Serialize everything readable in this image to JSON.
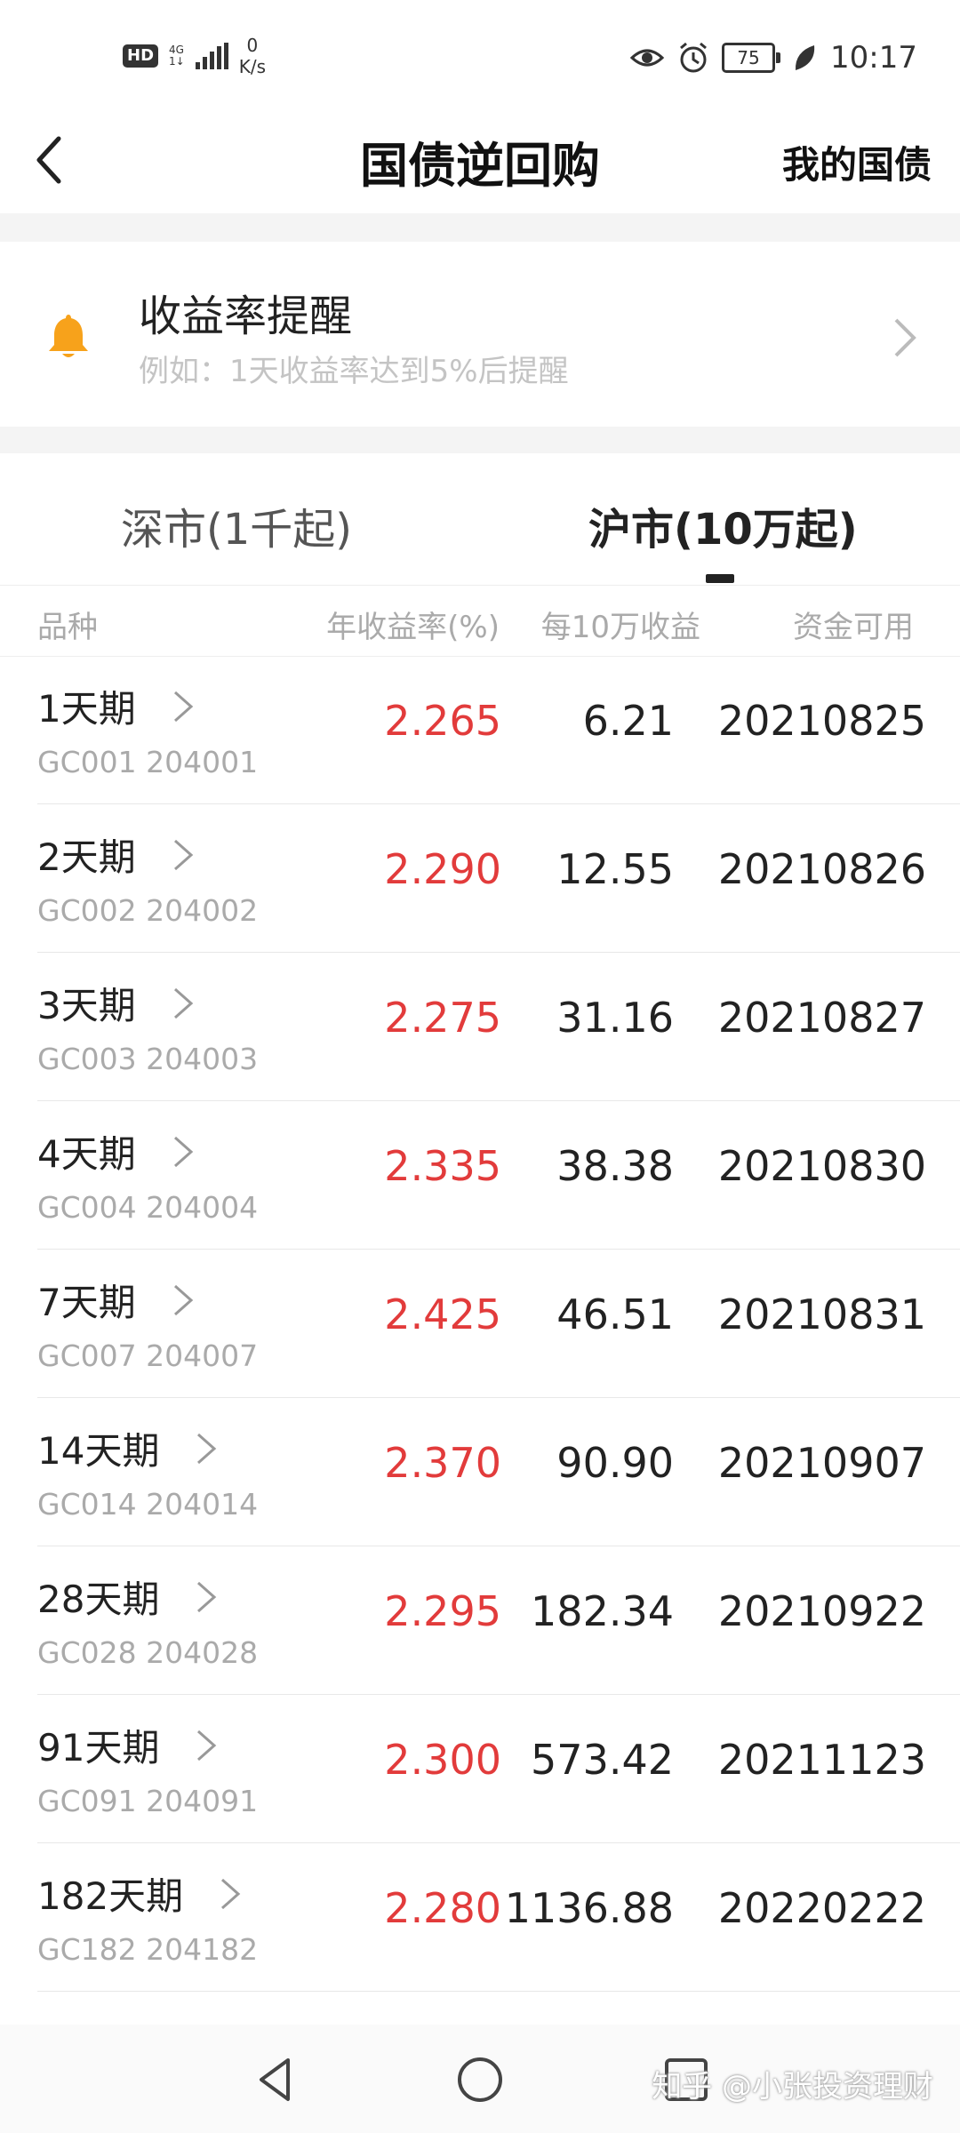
{
  "status_bar": {
    "hd_label": "HD",
    "network_type": "4G",
    "network_sub": "1↓",
    "speed_value": "0",
    "speed_unit": "K/s",
    "battery": "75",
    "time": "10:17"
  },
  "nav": {
    "title": "国债逆回购",
    "right_link": "我的国债"
  },
  "reminder": {
    "title": "收益率提醒",
    "subtitle": "例如：1天收益率达到5%后提醒",
    "icon": "bell-icon",
    "icon_color": "#f7a21b"
  },
  "tabs": [
    {
      "label": "深市(1千起)",
      "active": false
    },
    {
      "label": "沪市(10万起)",
      "active": true
    }
  ],
  "columns": [
    "品种",
    "年收益率(%)",
    "每10万收益",
    "资金可用"
  ],
  "rows": [
    {
      "name": "1天期",
      "code": "GC001  204001",
      "rate": "2.265",
      "income": "6.21",
      "date": "20210825"
    },
    {
      "name": "2天期",
      "code": "GC002  204002",
      "rate": "2.290",
      "income": "12.55",
      "date": "20210826"
    },
    {
      "name": "3天期",
      "code": "GC003  204003",
      "rate": "2.275",
      "income": "31.16",
      "date": "20210827"
    },
    {
      "name": "4天期",
      "code": "GC004  204004",
      "rate": "2.335",
      "income": "38.38",
      "date": "20210830"
    },
    {
      "name": "7天期",
      "code": "GC007  204007",
      "rate": "2.425",
      "income": "46.51",
      "date": "20210831"
    },
    {
      "name": "14天期",
      "code": "GC014  204014",
      "rate": "2.370",
      "income": "90.90",
      "date": "20210907"
    },
    {
      "name": "28天期",
      "code": "GC028  204028",
      "rate": "2.295",
      "income": "182.34",
      "date": "20210922"
    },
    {
      "name": "91天期",
      "code": "GC091  204091",
      "rate": "2.300",
      "income": "573.42",
      "date": "20211123"
    },
    {
      "name": "182天期",
      "code": "GC182  204182",
      "rate": "2.280",
      "income": "1136.88",
      "date": "20220222"
    }
  ],
  "colors": {
    "rate": "#e23b3b",
    "accent": "#f7a21b"
  },
  "watermark": "知乎 @小张投资理财"
}
